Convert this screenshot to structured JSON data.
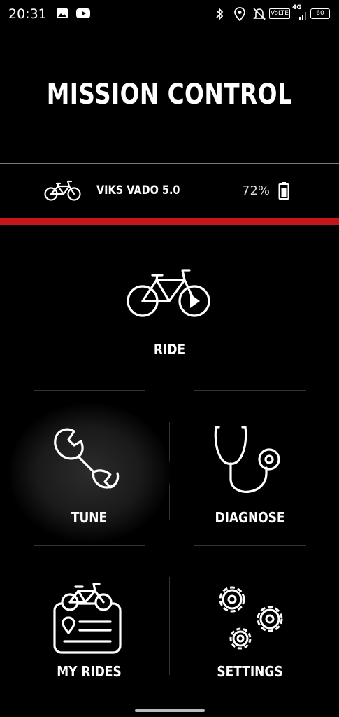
{
  "status_bar": {
    "time": "20:31",
    "left_icons": [
      "image-icon",
      "youtube-icon"
    ],
    "right_icons": [
      "bluetooth-icon",
      "location-icon",
      "mute-icon",
      "volte-icon",
      "signal-4g-icon",
      "battery-icon"
    ],
    "volte_label": "VoLTE",
    "network_label": "4G",
    "battery_level": "60"
  },
  "header": {
    "title": "MISSION CONTROL"
  },
  "bike": {
    "name": "VIKS VADO 5.0",
    "battery_percent": "72%"
  },
  "menu": {
    "ride": {
      "label": "RIDE",
      "icon": "bike-play-icon"
    },
    "tune": {
      "label": "TUNE",
      "icon": "wrench-icon"
    },
    "diagnose": {
      "label": "DIAGNOSE",
      "icon": "stethoscope-icon"
    },
    "my_rides": {
      "label": "MY RIDES",
      "icon": "ride-log-icon"
    },
    "settings": {
      "label": "SETTINGS",
      "icon": "gears-icon"
    }
  },
  "colors": {
    "background": "#000000",
    "accent": "#c4161c",
    "text": "#ffffff"
  }
}
